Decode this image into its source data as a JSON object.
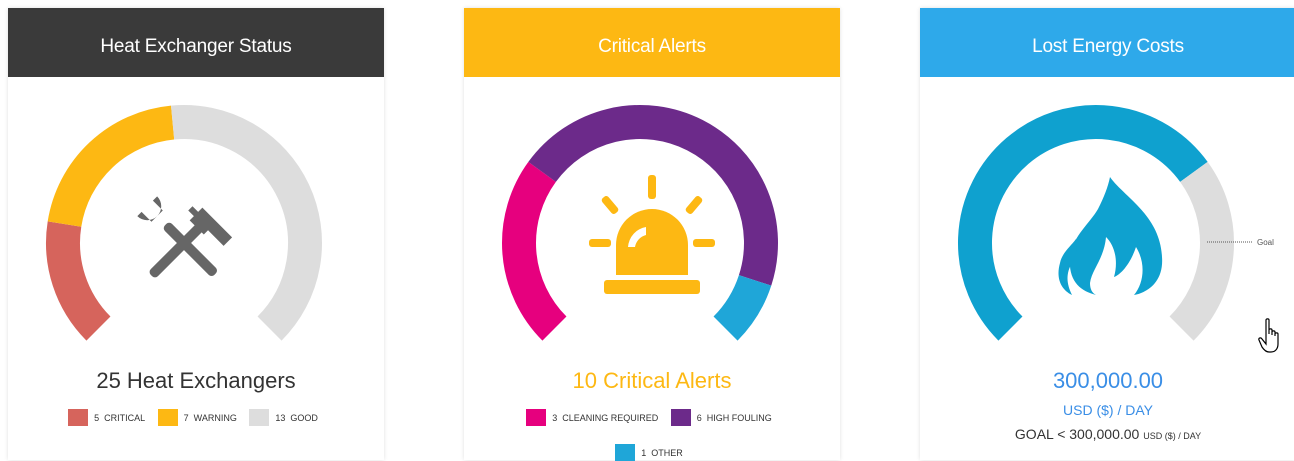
{
  "cards": {
    "status": {
      "title": "Heat Exchanger Status",
      "header_color": "#3a3a3a",
      "icon": "wrench-hammer-icon",
      "summary": "25 Heat Exchangers",
      "summary_color": "#333333",
      "legend": [
        {
          "count": "5",
          "label": "CRITICAL",
          "color": "#d6645c"
        },
        {
          "count": "7",
          "label": "WARNING",
          "color": "#fdb813"
        },
        {
          "count": "13",
          "label": "GOOD",
          "color": "#dddddd"
        }
      ]
    },
    "alerts": {
      "title": "Critical Alerts",
      "header_color": "#fdb813",
      "icon": "alarm-light-icon",
      "summary": "10 Critical Alerts",
      "summary_color": "#fdb813",
      "legend": [
        {
          "count": "3",
          "label": "CLEANING REQUIRED",
          "color": "#e6007e"
        },
        {
          "count": "6",
          "label": "HIGH FOULING",
          "color": "#6c2a8a"
        },
        {
          "count": "1",
          "label": "OTHER",
          "color": "#1fa6d8"
        }
      ]
    },
    "energy": {
      "title": "Lost Energy Costs",
      "header_color": "#2ea9ea",
      "icon": "flame-icon",
      "gauge_color": "#0fa1cf",
      "gauge_fraction": 0.7,
      "goal_label": "Goal",
      "value": "300,000.00",
      "unit": "USD ($) / DAY",
      "goal_text": "GOAL < 300,000.00",
      "goal_unit": "USD ($) / DAY",
      "value_color": "#3a8ee6"
    }
  },
  "track_color": "#dddddd",
  "cursor_icon": "hand-pointer-icon"
}
